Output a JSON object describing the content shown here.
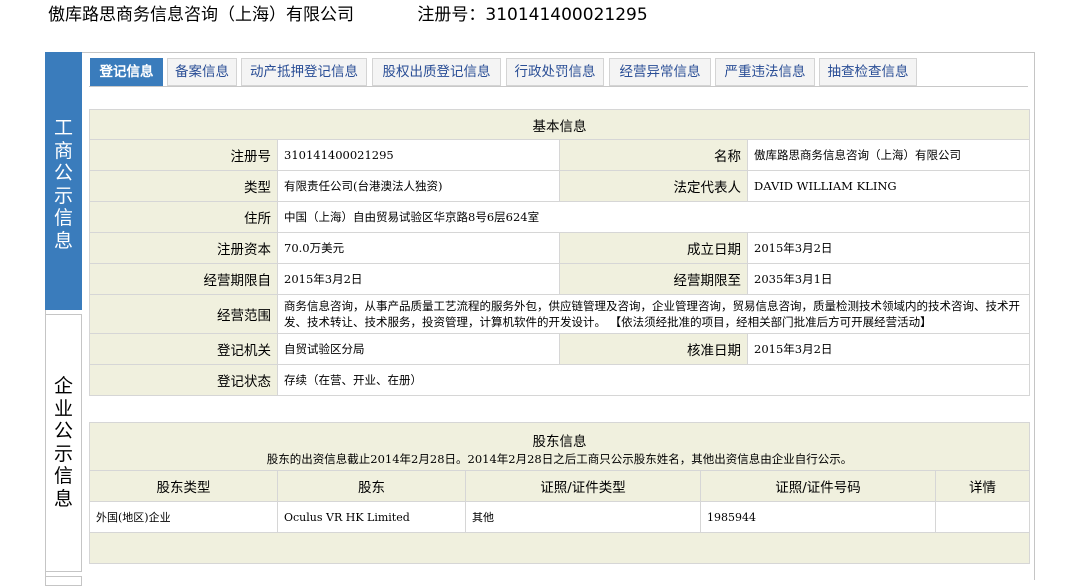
{
  "header": {
    "company": "傲库路思商务信息咨询（上海）有限公司",
    "reg_label": "注册号：",
    "reg_no": "310141400021295"
  },
  "side_nav": {
    "gongshang": [
      "工",
      "商",
      "公",
      "示",
      "信",
      "息"
    ],
    "qiye": [
      "企",
      "业",
      "公",
      "示",
      "信",
      "息"
    ]
  },
  "tabs": [
    "登记信息",
    "备案信息",
    "动产抵押登记信息",
    "股权出质登记信息",
    "行政处罚信息",
    "经营异常信息",
    "严重违法信息",
    "抽查检查信息"
  ],
  "basic": {
    "title": "基本信息",
    "labels": {
      "reg_no": "注册号",
      "name": "名称",
      "type": "类型",
      "legal_rep": "法定代表人",
      "address": "住所",
      "capital": "注册资本",
      "established": "成立日期",
      "term_from": "经营期限自",
      "term_to": "经营期限至",
      "scope": "经营范围",
      "authority": "登记机关",
      "approved": "核准日期",
      "status": "登记状态"
    },
    "values": {
      "reg_no": "310141400021295",
      "name": "傲库路思商务信息咨询（上海）有限公司",
      "type": "有限责任公司(台港澳法人独资)",
      "legal_rep": "DAVID WILLIAM KLING",
      "address": "中国（上海）自由贸易试验区华京路8号6层624室",
      "capital": "70.0万美元",
      "established": "2015年3月2日",
      "term_from": "2015年3月2日",
      "term_to": "2035年3月1日",
      "scope": "商务信息咨询，从事产品质量工艺流程的服务外包，供应链管理及咨询，企业管理咨询，贸易信息咨询，质量检测技术领域内的技术咨询、技术开发、技术转让、技术服务，投资管理，计算机软件的开发设计。 【依法须经批准的项目，经相关部门批准后方可开展经营活动】",
      "authority": "自贸试验区分局",
      "approved": "2015年3月2日",
      "status": "存续（在营、开业、在册）"
    }
  },
  "shareholders": {
    "title": "股东信息",
    "note": "股东的出资信息截止2014年2月28日。2014年2月28日之后工商只公示股东姓名，其他出资信息由企业自行公示。",
    "columns": [
      "股东类型",
      "股东",
      "证照/证件类型",
      "证照/证件号码",
      "详情"
    ],
    "rows": [
      [
        "外国(地区)企业",
        "Oculus VR HK Limited",
        "其他",
        "1985944",
        ""
      ]
    ]
  }
}
